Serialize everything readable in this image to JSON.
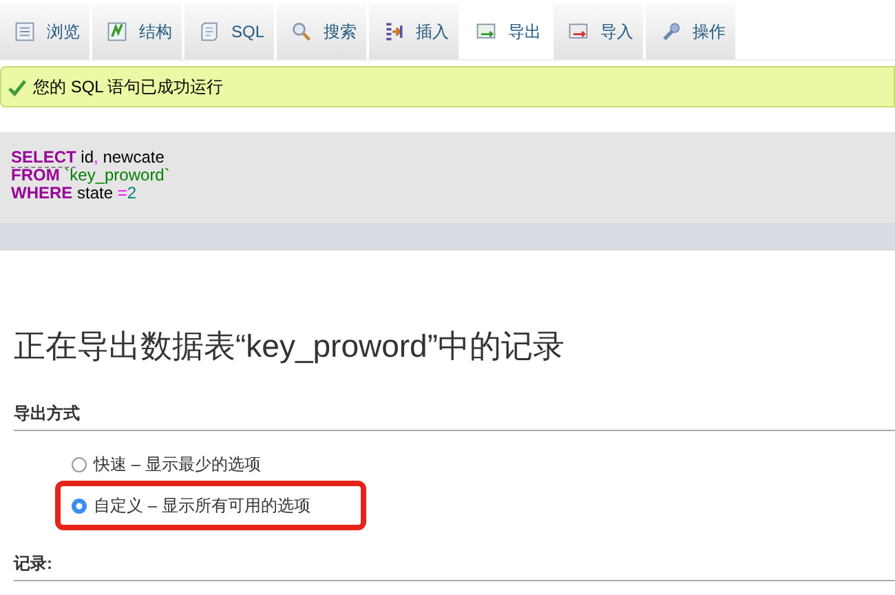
{
  "tabs": [
    {
      "label": "浏览",
      "kind": "browse",
      "selected": false
    },
    {
      "label": "结构",
      "kind": "structure",
      "selected": false
    },
    {
      "label": "SQL",
      "kind": "sql",
      "selected": false
    },
    {
      "label": "搜索",
      "kind": "search",
      "selected": false
    },
    {
      "label": "插入",
      "kind": "insert",
      "selected": false
    },
    {
      "label": "导出",
      "kind": "export",
      "selected": true
    },
    {
      "label": "导入",
      "kind": "import",
      "selected": false
    },
    {
      "label": "操作",
      "kind": "operations",
      "selected": false
    }
  ],
  "success_message": "您的 SQL 语句已成功运行",
  "sql_query": [
    [
      {
        "kind": "keyword",
        "text": "SELECT",
        "underline": true
      },
      {
        "kind": "plain",
        "text": " id"
      },
      {
        "kind": "punct",
        "text": ","
      },
      {
        "kind": "plain",
        "text": " newcate"
      }
    ],
    [
      {
        "kind": "keyword",
        "text": "FROM"
      },
      {
        "kind": "string",
        "text": " `key_proword`"
      }
    ],
    [
      {
        "kind": "keyword",
        "text": "WHERE"
      },
      {
        "kind": "plain",
        "text": " state "
      },
      {
        "kind": "operator",
        "text": "="
      },
      {
        "kind": "number",
        "text": "2"
      }
    ]
  ],
  "heading": "正在导出数据表“key_proword”中的记录",
  "export_method": {
    "title": "导出方式",
    "options": [
      {
        "label": "快速 – 显示最少的选项",
        "selected": false,
        "highlighted": false
      },
      {
        "label": "自定义 – 显示所有可用的选项",
        "selected": true,
        "highlighted": true
      }
    ]
  },
  "records_title": "记录:"
}
